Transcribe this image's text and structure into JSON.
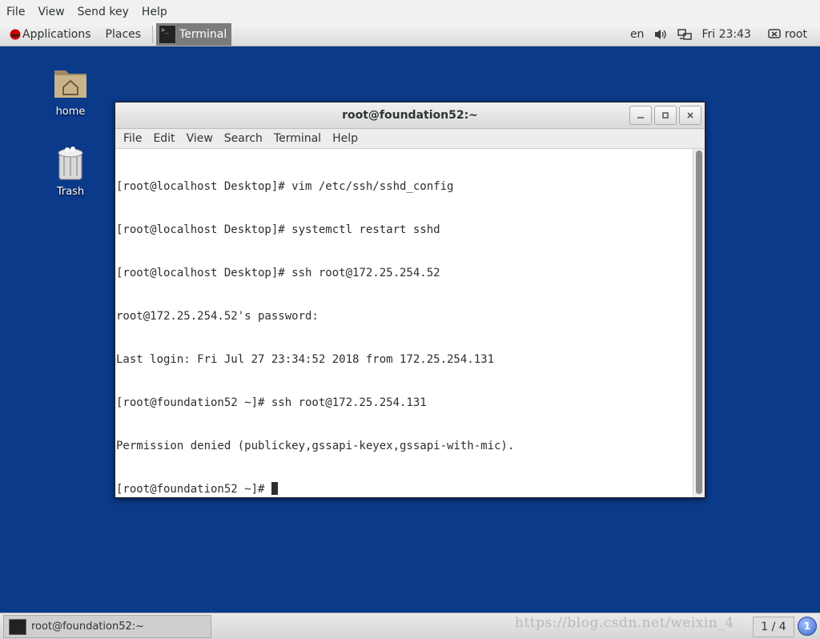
{
  "viewer_menu": [
    "File",
    "View",
    "Send key",
    "Help"
  ],
  "topbar": {
    "applications": "Applications",
    "places": "Places",
    "active_task": "Terminal",
    "lang": "en",
    "clock": "Fri 23:43",
    "user": "root"
  },
  "desktop": {
    "home_label": "home",
    "trash_label": "Trash"
  },
  "terminal": {
    "title": "root@foundation52:~",
    "menu": [
      "File",
      "Edit",
      "View",
      "Search",
      "Terminal",
      "Help"
    ],
    "lines": [
      "[root@localhost Desktop]# vim /etc/ssh/sshd_config",
      "[root@localhost Desktop]# systemctl restart sshd",
      "[root@localhost Desktop]# ssh root@172.25.254.52",
      "root@172.25.254.52's password: ",
      "Last login: Fri Jul 27 23:34:52 2018 from 172.25.254.131",
      "[root@foundation52 ~]# ssh root@172.25.254.131",
      "Permission denied (publickey,gssapi-keyex,gssapi-with-mic).",
      "[root@foundation52 ~]# "
    ]
  },
  "bottom_panel": {
    "task_label": "root@foundation52:~",
    "watermark": "https://blog.csdn.net/weixin_4",
    "workspace": "1 / 4",
    "notification_count": "1"
  },
  "colors": {
    "desktop_bg": "#0b3a8a",
    "terminal_bg": "#ffffff",
    "terminal_fg": "#2e2e2e"
  }
}
